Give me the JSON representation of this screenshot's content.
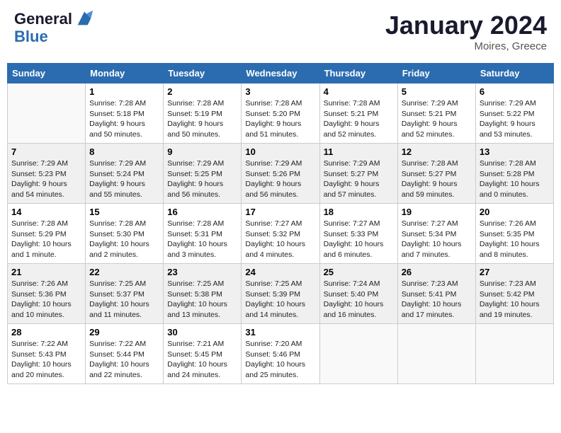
{
  "header": {
    "logo_line1": "General",
    "logo_line2": "Blue",
    "month_title": "January 2024",
    "location": "Moires, Greece"
  },
  "weekdays": [
    "Sunday",
    "Monday",
    "Tuesday",
    "Wednesday",
    "Thursday",
    "Friday",
    "Saturday"
  ],
  "weeks": [
    [
      {
        "day": "",
        "sunrise": "",
        "sunset": "",
        "daylight": ""
      },
      {
        "day": "1",
        "sunrise": "Sunrise: 7:28 AM",
        "sunset": "Sunset: 5:18 PM",
        "daylight": "Daylight: 9 hours and 50 minutes."
      },
      {
        "day": "2",
        "sunrise": "Sunrise: 7:28 AM",
        "sunset": "Sunset: 5:19 PM",
        "daylight": "Daylight: 9 hours and 50 minutes."
      },
      {
        "day": "3",
        "sunrise": "Sunrise: 7:28 AM",
        "sunset": "Sunset: 5:20 PM",
        "daylight": "Daylight: 9 hours and 51 minutes."
      },
      {
        "day": "4",
        "sunrise": "Sunrise: 7:28 AM",
        "sunset": "Sunset: 5:21 PM",
        "daylight": "Daylight: 9 hours and 52 minutes."
      },
      {
        "day": "5",
        "sunrise": "Sunrise: 7:29 AM",
        "sunset": "Sunset: 5:21 PM",
        "daylight": "Daylight: 9 hours and 52 minutes."
      },
      {
        "day": "6",
        "sunrise": "Sunrise: 7:29 AM",
        "sunset": "Sunset: 5:22 PM",
        "daylight": "Daylight: 9 hours and 53 minutes."
      }
    ],
    [
      {
        "day": "7",
        "sunrise": "Sunrise: 7:29 AM",
        "sunset": "Sunset: 5:23 PM",
        "daylight": "Daylight: 9 hours and 54 minutes."
      },
      {
        "day": "8",
        "sunrise": "Sunrise: 7:29 AM",
        "sunset": "Sunset: 5:24 PM",
        "daylight": "Daylight: 9 hours and 55 minutes."
      },
      {
        "day": "9",
        "sunrise": "Sunrise: 7:29 AM",
        "sunset": "Sunset: 5:25 PM",
        "daylight": "Daylight: 9 hours and 56 minutes."
      },
      {
        "day": "10",
        "sunrise": "Sunrise: 7:29 AM",
        "sunset": "Sunset: 5:26 PM",
        "daylight": "Daylight: 9 hours and 56 minutes."
      },
      {
        "day": "11",
        "sunrise": "Sunrise: 7:29 AM",
        "sunset": "Sunset: 5:27 PM",
        "daylight": "Daylight: 9 hours and 57 minutes."
      },
      {
        "day": "12",
        "sunrise": "Sunrise: 7:28 AM",
        "sunset": "Sunset: 5:27 PM",
        "daylight": "Daylight: 9 hours and 59 minutes."
      },
      {
        "day": "13",
        "sunrise": "Sunrise: 7:28 AM",
        "sunset": "Sunset: 5:28 PM",
        "daylight": "Daylight: 10 hours and 0 minutes."
      }
    ],
    [
      {
        "day": "14",
        "sunrise": "Sunrise: 7:28 AM",
        "sunset": "Sunset: 5:29 PM",
        "daylight": "Daylight: 10 hours and 1 minute."
      },
      {
        "day": "15",
        "sunrise": "Sunrise: 7:28 AM",
        "sunset": "Sunset: 5:30 PM",
        "daylight": "Daylight: 10 hours and 2 minutes."
      },
      {
        "day": "16",
        "sunrise": "Sunrise: 7:28 AM",
        "sunset": "Sunset: 5:31 PM",
        "daylight": "Daylight: 10 hours and 3 minutes."
      },
      {
        "day": "17",
        "sunrise": "Sunrise: 7:27 AM",
        "sunset": "Sunset: 5:32 PM",
        "daylight": "Daylight: 10 hours and 4 minutes."
      },
      {
        "day": "18",
        "sunrise": "Sunrise: 7:27 AM",
        "sunset": "Sunset: 5:33 PM",
        "daylight": "Daylight: 10 hours and 6 minutes."
      },
      {
        "day": "19",
        "sunrise": "Sunrise: 7:27 AM",
        "sunset": "Sunset: 5:34 PM",
        "daylight": "Daylight: 10 hours and 7 minutes."
      },
      {
        "day": "20",
        "sunrise": "Sunrise: 7:26 AM",
        "sunset": "Sunset: 5:35 PM",
        "daylight": "Daylight: 10 hours and 8 minutes."
      }
    ],
    [
      {
        "day": "21",
        "sunrise": "Sunrise: 7:26 AM",
        "sunset": "Sunset: 5:36 PM",
        "daylight": "Daylight: 10 hours and 10 minutes."
      },
      {
        "day": "22",
        "sunrise": "Sunrise: 7:25 AM",
        "sunset": "Sunset: 5:37 PM",
        "daylight": "Daylight: 10 hours and 11 minutes."
      },
      {
        "day": "23",
        "sunrise": "Sunrise: 7:25 AM",
        "sunset": "Sunset: 5:38 PM",
        "daylight": "Daylight: 10 hours and 13 minutes."
      },
      {
        "day": "24",
        "sunrise": "Sunrise: 7:25 AM",
        "sunset": "Sunset: 5:39 PM",
        "daylight": "Daylight: 10 hours and 14 minutes."
      },
      {
        "day": "25",
        "sunrise": "Sunrise: 7:24 AM",
        "sunset": "Sunset: 5:40 PM",
        "daylight": "Daylight: 10 hours and 16 minutes."
      },
      {
        "day": "26",
        "sunrise": "Sunrise: 7:23 AM",
        "sunset": "Sunset: 5:41 PM",
        "daylight": "Daylight: 10 hours and 17 minutes."
      },
      {
        "day": "27",
        "sunrise": "Sunrise: 7:23 AM",
        "sunset": "Sunset: 5:42 PM",
        "daylight": "Daylight: 10 hours and 19 minutes."
      }
    ],
    [
      {
        "day": "28",
        "sunrise": "Sunrise: 7:22 AM",
        "sunset": "Sunset: 5:43 PM",
        "daylight": "Daylight: 10 hours and 20 minutes."
      },
      {
        "day": "29",
        "sunrise": "Sunrise: 7:22 AM",
        "sunset": "Sunset: 5:44 PM",
        "daylight": "Daylight: 10 hours and 22 minutes."
      },
      {
        "day": "30",
        "sunrise": "Sunrise: 7:21 AM",
        "sunset": "Sunset: 5:45 PM",
        "daylight": "Daylight: 10 hours and 24 minutes."
      },
      {
        "day": "31",
        "sunrise": "Sunrise: 7:20 AM",
        "sunset": "Sunset: 5:46 PM",
        "daylight": "Daylight: 10 hours and 25 minutes."
      },
      {
        "day": "",
        "sunrise": "",
        "sunset": "",
        "daylight": ""
      },
      {
        "day": "",
        "sunrise": "",
        "sunset": "",
        "daylight": ""
      },
      {
        "day": "",
        "sunrise": "",
        "sunset": "",
        "daylight": ""
      }
    ]
  ]
}
